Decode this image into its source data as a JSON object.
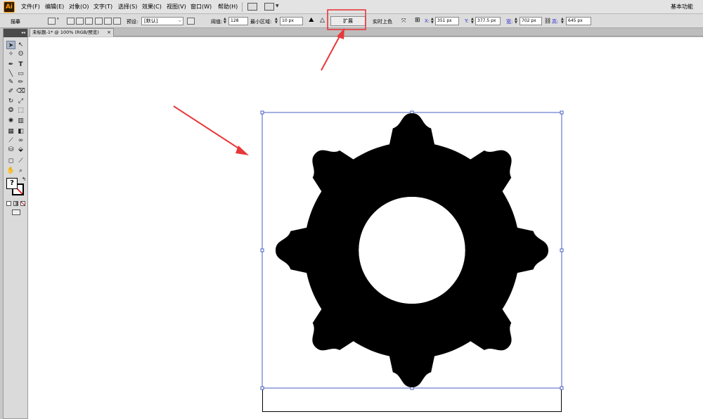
{
  "app": {
    "logo": "Ai",
    "menu": [
      "文件(F)",
      "编辑(E)",
      "对象(O)",
      "文字(T)",
      "选择(S)",
      "效果(C)",
      "视图(V)",
      "窗口(W)",
      "帮助(H)"
    ],
    "workspace": "基本功能"
  },
  "controlbar": {
    "mode_label": "描摹",
    "preset_label": "预设:",
    "preset_value": "[默认]",
    "threshold_label": "阈值:",
    "threshold_value": "128",
    "min_area_label": "最小区域:",
    "min_area_value": "10 px",
    "expand_label": "扩展",
    "live_paint_label": "实时上色",
    "x_label": "X:",
    "x_value": "351 px",
    "y_label": "Y:",
    "y_value": "377.5 px",
    "w_label": "宽:",
    "w_value": "702 px",
    "h_label": "高:",
    "h_value": "645 px"
  },
  "document": {
    "tab_title": "未标题-1* @ 100% (RGB/预览)",
    "close_glyph": "×"
  },
  "toolbox": {
    "fill_glyph": "?"
  },
  "colors": {
    "arrow_red": "#e8383b",
    "selection_blue": "#4a5fc1",
    "gear": "#000000"
  }
}
